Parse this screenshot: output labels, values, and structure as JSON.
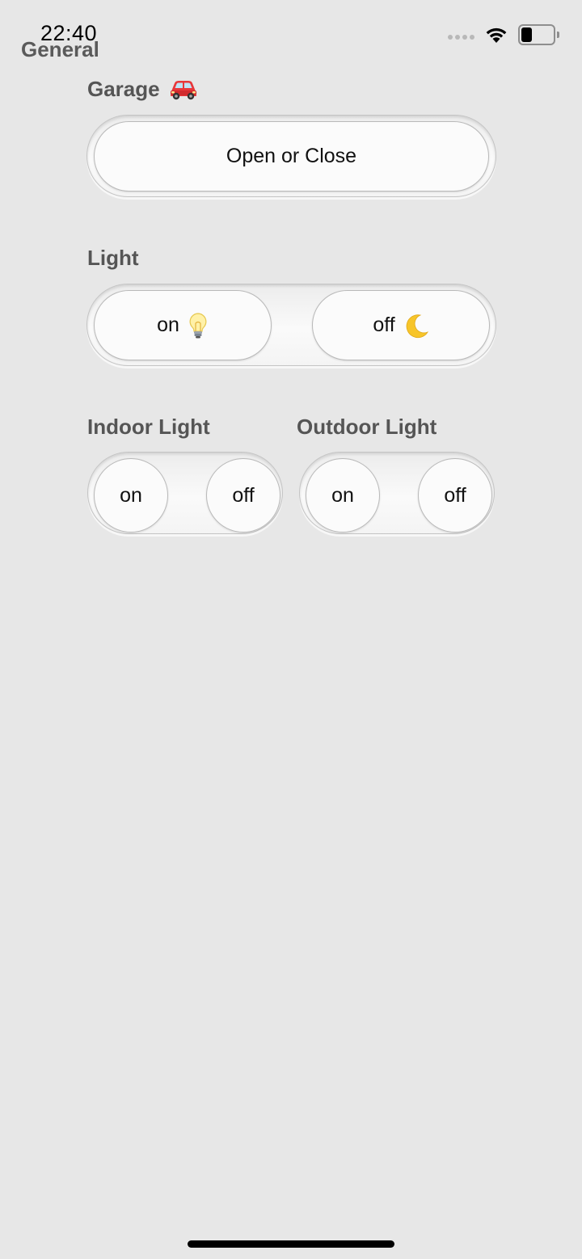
{
  "status_bar": {
    "time": "22:40",
    "signal_icon": "cellular-dots-icon",
    "wifi_icon": "wifi-icon",
    "battery_icon": "battery-icon",
    "battery_level": 0.35
  },
  "page": {
    "title": "General"
  },
  "garage": {
    "label": "Garage",
    "icon": "car-icon",
    "button_label": "Open or Close"
  },
  "light": {
    "label": "Light",
    "on_label": "on",
    "on_icon": "light-bulb-icon",
    "off_label": "off",
    "off_icon": "crescent-moon-icon"
  },
  "indoor_light": {
    "label": "Indoor Light",
    "on_label": "on",
    "off_label": "off"
  },
  "outdoor_light": {
    "label": "Outdoor Light",
    "on_label": "on",
    "off_label": "off"
  },
  "colors": {
    "background": "#e7e7e7",
    "label": "#555555",
    "button": "#fbfbfb",
    "button_border": "#b9b9b9"
  }
}
